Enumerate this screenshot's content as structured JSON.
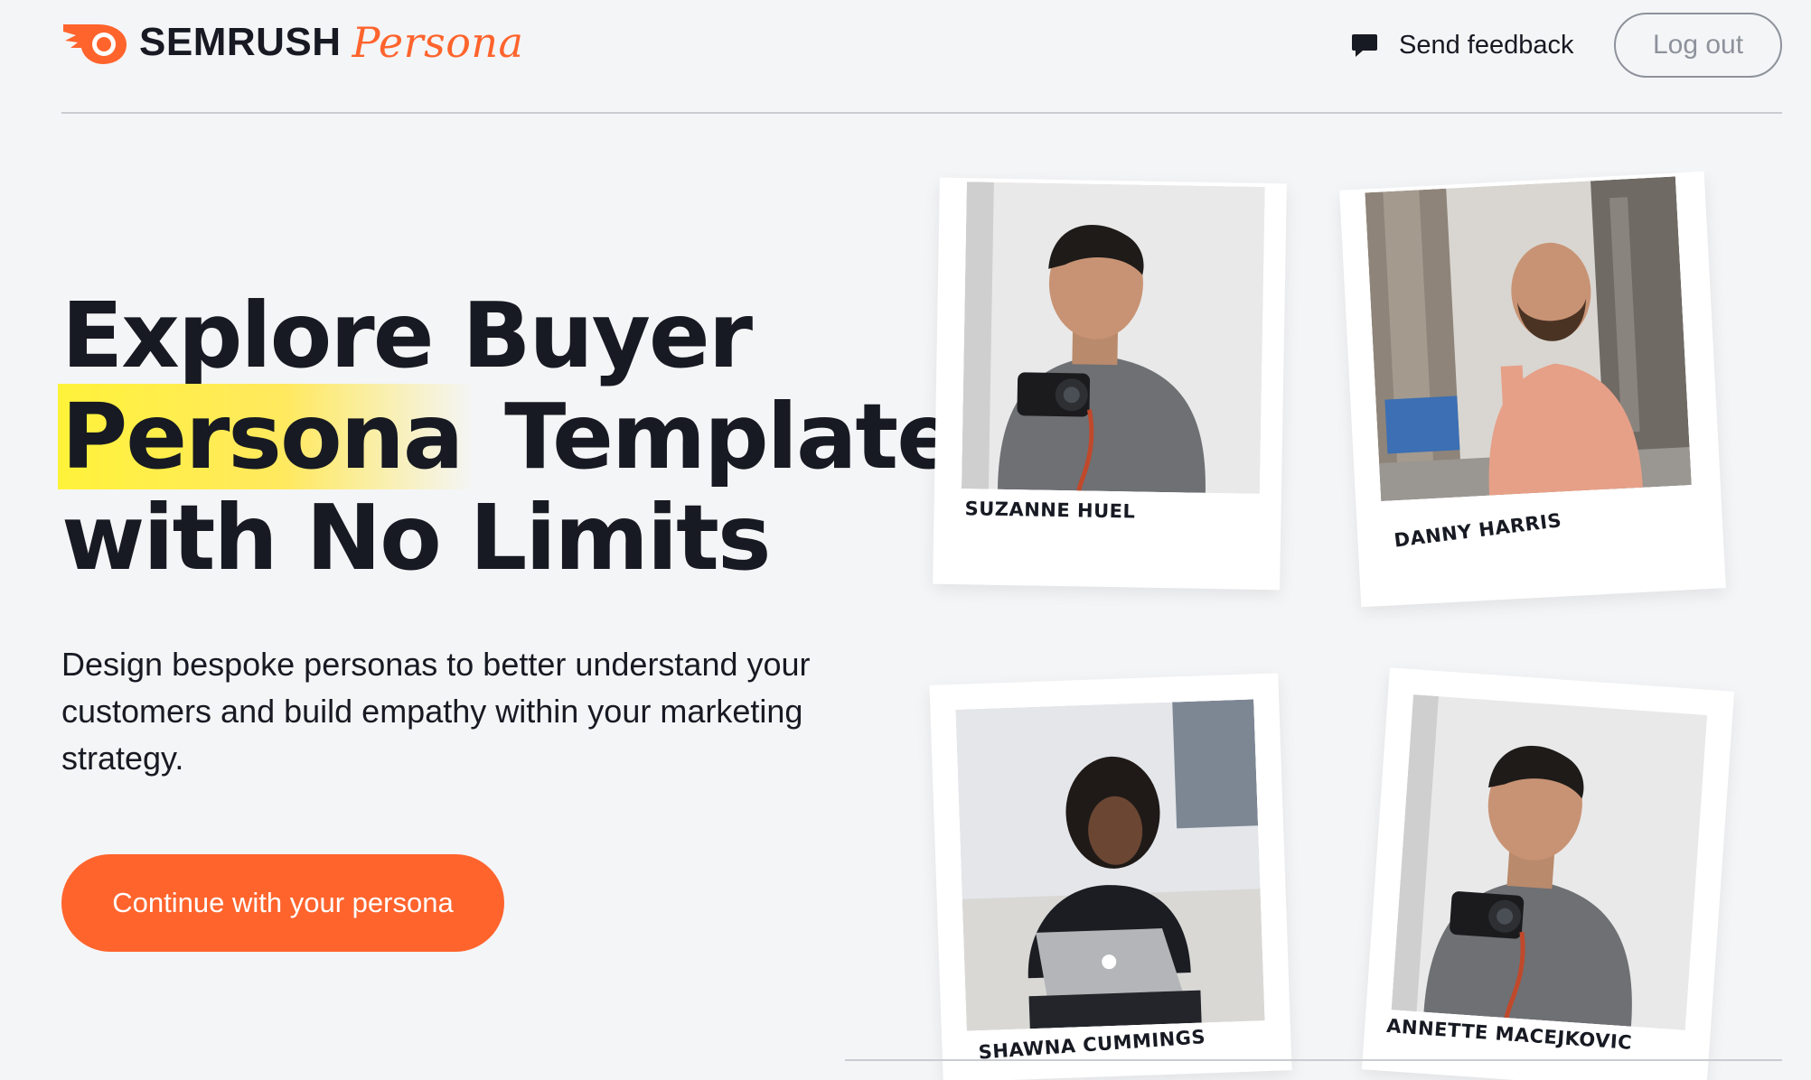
{
  "header": {
    "logo_wordmark": "SEMRUSH",
    "logo_product": "Persona",
    "feedback_label": "Send feedback",
    "logout_label": "Log out",
    "accent_color": "#ff642d"
  },
  "hero": {
    "title_line1": "Explore Buyer",
    "title_highlight": "Persona",
    "title_line2_rest": " Templates",
    "title_line3": "with No Limits",
    "description": "Design bespoke personas to better understand your customers and build empathy within your marketing strategy.",
    "cta_label": "Continue with your persona"
  },
  "personas": [
    {
      "name": "SUZANNE HUEL",
      "icon": "man-with-camera"
    },
    {
      "name": "DANNY HARRIS",
      "icon": "bearded-man-city"
    },
    {
      "name": "SHAWNA CUMMINGS",
      "icon": "woman-with-laptop"
    },
    {
      "name": "ANNETTE MACEJKOVIC",
      "icon": "man-with-camera"
    }
  ]
}
